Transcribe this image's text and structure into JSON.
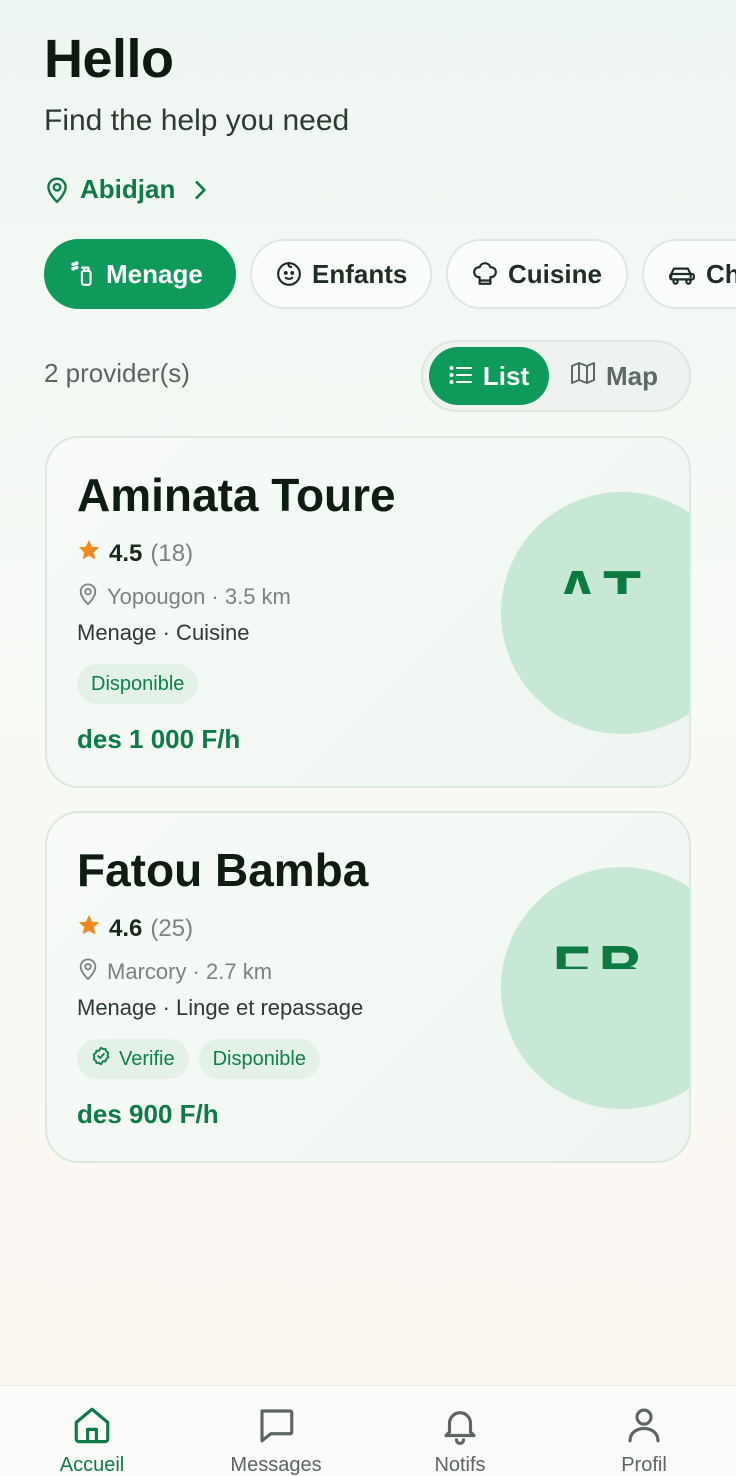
{
  "header": {
    "title": "Hello",
    "subtitle": "Find the help you need"
  },
  "location": {
    "city": "Abidjan",
    "icon": "location-pin-icon"
  },
  "categories": [
    {
      "label": "Menage",
      "icon": "spray-bottle-icon",
      "active": true
    },
    {
      "label": "Enfants",
      "icon": "baby-face-icon",
      "active": false
    },
    {
      "label": "Cuisine",
      "icon": "chef-hat-icon",
      "active": false
    },
    {
      "label": "Ch",
      "icon": "car-icon",
      "active": false
    }
  ],
  "results": {
    "count_label": "2 provider(s)"
  },
  "view_toggle": {
    "list_label": "List",
    "map_label": "Map",
    "selected": "List"
  },
  "providers": [
    {
      "name": "Aminata Toure",
      "initials": "AT",
      "rating": "4.5",
      "reviews": "(18)",
      "location": "Yopougon · 3.5 km",
      "services": "Menage · Cuisine",
      "badges": [
        "Disponible"
      ],
      "price": "des 1 000 F/h"
    },
    {
      "name": "Fatou Bamba",
      "initials": "FB",
      "rating": "4.6",
      "reviews": "(25)",
      "location": "Marcory · 2.7 km",
      "services": "Menage · Linge et repassage",
      "verified_label": "Verifie",
      "badges": [
        "Disponible"
      ],
      "price": "des 900 F/h"
    }
  ],
  "colors": {
    "accent": "#0e9a5a",
    "accent_dark": "#0e7a45",
    "star": "#f08a1e",
    "avatar_bg": "#c7e8d4"
  },
  "bottom_nav": [
    {
      "label": "Accueil",
      "icon": "home-icon",
      "active": true
    },
    {
      "label": "Messages",
      "icon": "chat-bubble-icon",
      "active": false
    },
    {
      "label": "Notifs",
      "icon": "bell-icon",
      "active": false
    },
    {
      "label": "Profil",
      "icon": "user-icon",
      "active": false
    }
  ]
}
